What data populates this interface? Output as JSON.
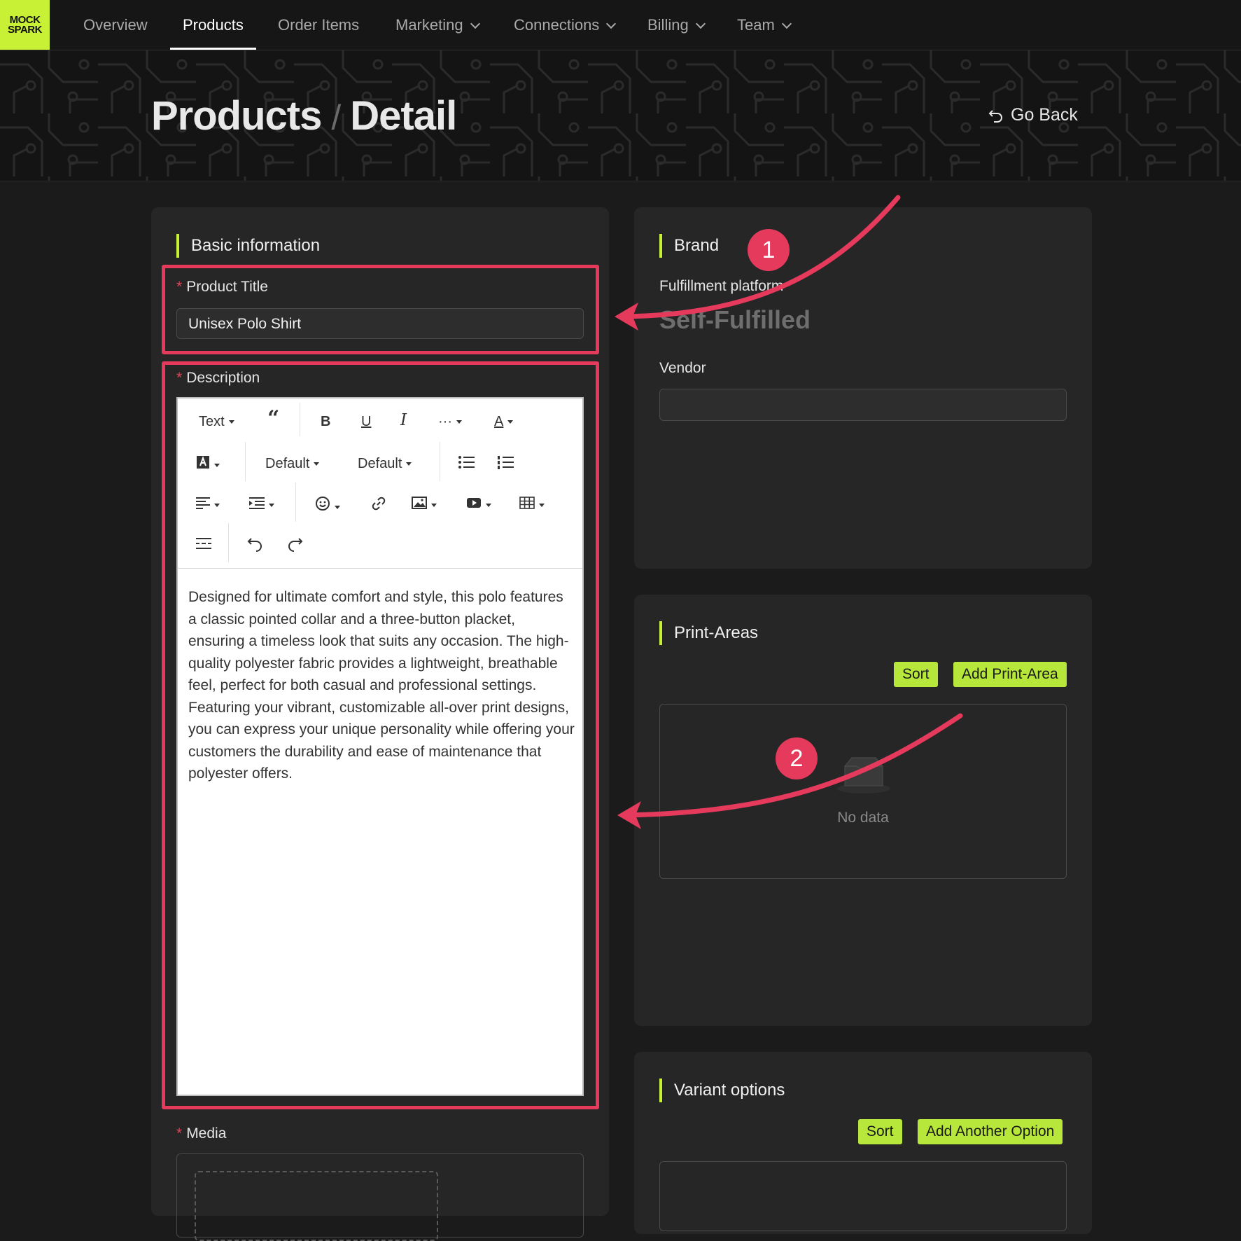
{
  "logo": {
    "line1": "MOCK",
    "line2": "SPARK"
  },
  "nav": {
    "items": [
      {
        "label": "Overview"
      },
      {
        "label": "Products"
      },
      {
        "label": "Order Items"
      },
      {
        "label": "Marketing"
      },
      {
        "label": "Connections"
      },
      {
        "label": "Billing"
      },
      {
        "label": "Team"
      }
    ],
    "active": "Products"
  },
  "header": {
    "crumb1": "Products",
    "separator": "/",
    "crumb2": "Detail",
    "go_back": "Go Back"
  },
  "basic": {
    "title": "Basic information",
    "product_title_label": "Product Title",
    "product_title_value": "Unisex Polo Shirt",
    "description_label": "Description",
    "media_label": "Media",
    "required_mark": "*"
  },
  "editor": {
    "text_style": "Text",
    "font_family": "Default",
    "font_size": "Default",
    "more": "···",
    "font_color_letter": "A",
    "content": "Designed for ultimate comfort and style, this polo features a classic pointed collar and a three-button placket, ensuring a timeless look that suits any occasion. The high-quality polyester fabric provides a lightweight, breathable feel, perfect for both casual and professional settings. Featuring your vibrant, customizable all-over print designs, you can express your unique personality while offering your customers the durability and ease of maintenance that polyester offers."
  },
  "brand": {
    "title": "Brand",
    "fulfillment_label": "Fulfillment platform",
    "fulfillment_value": "Self-Fulfilled",
    "vendor_label": "Vendor",
    "vendor_value": ""
  },
  "print_areas": {
    "title": "Print-Areas",
    "sort": "Sort",
    "add": "Add Print-Area",
    "empty": "No data"
  },
  "variants": {
    "title": "Variant options",
    "sort": "Sort",
    "add": "Add Another Option"
  },
  "annotations": {
    "badge1": "1",
    "badge2": "2"
  },
  "colors": {
    "accent": "#c8f135",
    "highlight": "#e63a5d",
    "background": "#1b1b1b",
    "card": "#262626"
  }
}
